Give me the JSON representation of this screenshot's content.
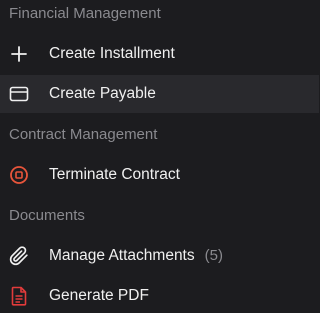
{
  "menu": {
    "sections": [
      {
        "title": "Financial Management",
        "items": [
          {
            "label": "Create Installment",
            "icon": "plus-icon"
          },
          {
            "label": "Create Payable",
            "icon": "credit-card-icon",
            "active": true
          }
        ]
      },
      {
        "title": "Contract Management",
        "items": [
          {
            "label": "Terminate Contract",
            "icon": "stop-circle-icon",
            "icon_color": "#e8553b"
          }
        ]
      },
      {
        "title": "Documents",
        "items": [
          {
            "label": "Manage Attachments",
            "count": "(5)",
            "icon": "paperclip-icon"
          },
          {
            "label": "Generate PDF",
            "icon": "pdf-file-icon",
            "icon_color": "#e23b3b"
          }
        ]
      }
    ]
  },
  "colors": {
    "background": "#1c1c1f",
    "active_row": "#29292d",
    "section_text": "#8a8a8f",
    "item_text": "#f0f0f0",
    "danger": "#e8553b",
    "pdf_red": "#e23b3b"
  }
}
